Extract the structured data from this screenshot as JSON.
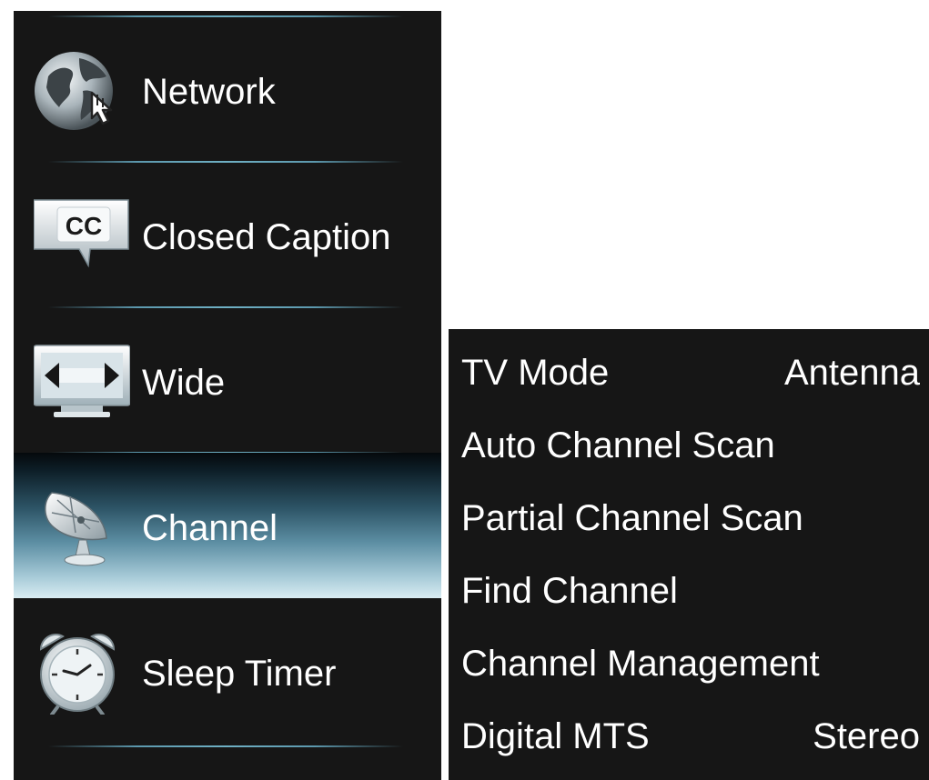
{
  "sidebar": {
    "items": [
      {
        "label": "Network",
        "icon": "globe-pointer-icon",
        "selected": false
      },
      {
        "label": "Closed Caption",
        "icon": "cc-speech-bubble-icon",
        "selected": false
      },
      {
        "label": "Wide",
        "icon": "widescreen-arrows-icon",
        "selected": false
      },
      {
        "label": "Channel",
        "icon": "satellite-dish-icon",
        "selected": true
      },
      {
        "label": "Sleep Timer",
        "icon": "alarm-clock-icon",
        "selected": false
      }
    ]
  },
  "channel_menu": {
    "rows": [
      {
        "label": "TV Mode",
        "value": "Antenna"
      },
      {
        "label": "Auto Channel Scan"
      },
      {
        "label": "Partial Channel Scan"
      },
      {
        "label": "Find Channel"
      },
      {
        "label": "Channel Management"
      },
      {
        "label": "Digital MTS",
        "value": "Stereo"
      }
    ]
  },
  "colors": {
    "menu_background": "#161616",
    "text": "#ffffff",
    "divider": "#6fb0c4",
    "selected_gradient_top": "#05090c",
    "selected_gradient_bottom": "#d9ecf2"
  }
}
